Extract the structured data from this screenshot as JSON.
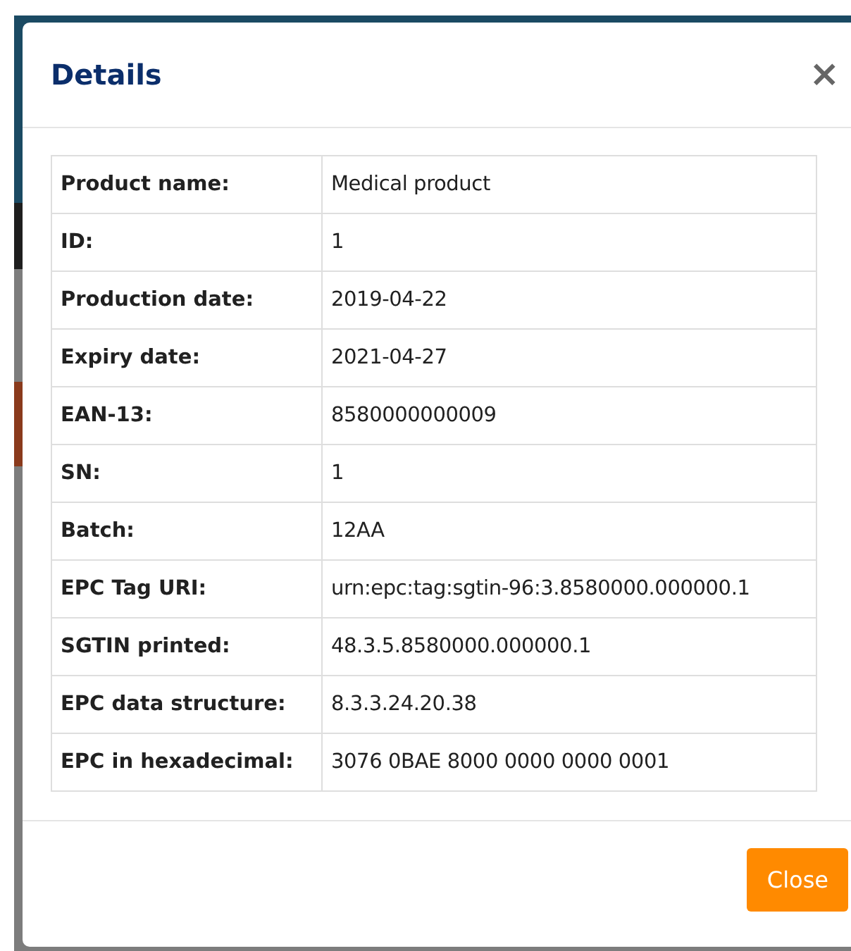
{
  "dialog": {
    "title": "Details",
    "close_icon": "×",
    "rows": [
      {
        "label": "Product name:",
        "value": "Medical product"
      },
      {
        "label": "ID:",
        "value": "1"
      },
      {
        "label": "Production date:",
        "value": "2019-04-22"
      },
      {
        "label": "Expiry date:",
        "value": "2021-04-27"
      },
      {
        "label": "EAN-13:",
        "value": "8580000000009"
      },
      {
        "label": "SN:",
        "value": "1"
      },
      {
        "label": "Batch:",
        "value": "12AA"
      },
      {
        "label": "EPC Tag URI:",
        "value": "urn:epc:tag:sgtin-96:3.8580000.000000.1"
      },
      {
        "label": "SGTIN printed:",
        "value": "48.3.5.8580000.000000.1"
      },
      {
        "label": "EPC data structure:",
        "value": "8.3.3.24.20.38"
      },
      {
        "label": "EPC in hexadecimal:",
        "value": "3076 0BAE 8000 0000 0000 0001"
      }
    ],
    "buttons": [
      "Close"
    ]
  }
}
